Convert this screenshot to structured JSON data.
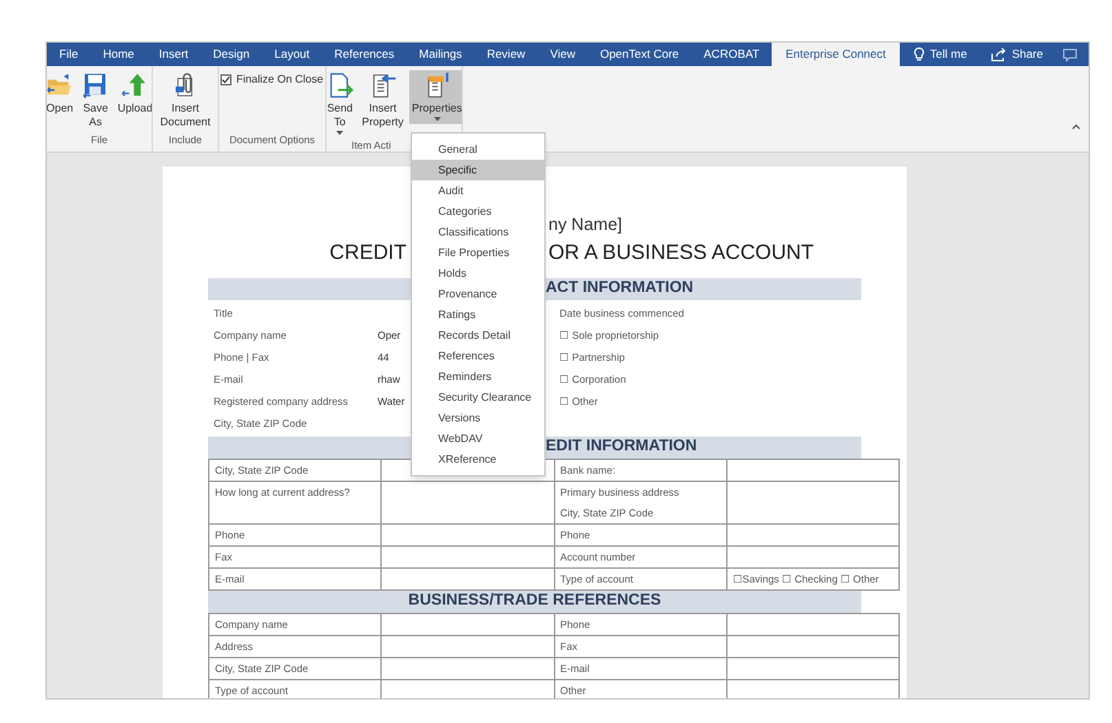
{
  "tabs": [
    {
      "label": "File",
      "selected": false
    },
    {
      "label": "Home",
      "selected": false
    },
    {
      "label": "Insert",
      "selected": false
    },
    {
      "label": "Design",
      "selected": false
    },
    {
      "label": "Layout",
      "selected": false
    },
    {
      "label": "References",
      "selected": false
    },
    {
      "label": "Mailings",
      "selected": false
    },
    {
      "label": "Review",
      "selected": false
    },
    {
      "label": "View",
      "selected": false
    },
    {
      "label": "OpenText Core",
      "selected": false
    },
    {
      "label": "ACROBAT",
      "selected": false
    },
    {
      "label": "Enterprise Connect",
      "selected": true
    }
  ],
  "tell_me": "Tell me",
  "share": "Share",
  "ribbon": {
    "groups": [
      {
        "label": "File",
        "items": [
          {
            "kind": "button",
            "label": "Open"
          },
          {
            "kind": "button",
            "label": "Save As"
          },
          {
            "kind": "button",
            "label": "Upload"
          }
        ]
      },
      {
        "label": "Include",
        "items": [
          {
            "kind": "button",
            "label": "Insert Document"
          }
        ]
      },
      {
        "label": "Document Options",
        "items": [
          {
            "kind": "checkbox",
            "label": "Finalize On Close",
            "checked": true
          }
        ]
      },
      {
        "label": "Item Acti",
        "items": [
          {
            "kind": "button",
            "label": "Send To",
            "dropdown": true
          },
          {
            "kind": "button",
            "label": "Insert Property"
          },
          {
            "kind": "button",
            "label": "Properties",
            "dropdown": true,
            "pressed": true
          }
        ]
      }
    ]
  },
  "menu": {
    "items": [
      {
        "label": "General",
        "selected": false
      },
      {
        "label": "Specific",
        "selected": true
      },
      {
        "label": "Audit",
        "selected": false
      },
      {
        "label": "Categories",
        "selected": false
      },
      {
        "label": "Classifications",
        "selected": false
      },
      {
        "label": "File Properties",
        "selected": false
      },
      {
        "label": "Holds",
        "selected": false
      },
      {
        "label": "Provenance",
        "selected": false
      },
      {
        "label": "Ratings",
        "selected": false
      },
      {
        "label": "Records Detail",
        "selected": false
      },
      {
        "label": "References",
        "selected": false
      },
      {
        "label": "Reminders",
        "selected": false
      },
      {
        "label": "Security Clearance",
        "selected": false
      },
      {
        "label": "Versions",
        "selected": false
      },
      {
        "label": "WebDAV",
        "selected": false
      },
      {
        "label": "XReference",
        "selected": false
      }
    ]
  },
  "document": {
    "company_name": "ny Name]",
    "title_left": "CREDIT",
    "title_right": "OR A BUSINESS ACCOUNT",
    "contact": {
      "heading": "ACT INFORMATION",
      "rows": [
        {
          "label": "Title",
          "right": "Date business commenced"
        },
        {
          "label": "Company name",
          "value": "Oper",
          "right": "☐ Sole proprietorship"
        },
        {
          "label": "Phone | Fax",
          "value": "44",
          "right": "☐ Partnership"
        },
        {
          "label": "E-mail",
          "value": "rhaw",
          "right": "☐ Corporation"
        },
        {
          "label": "Registered company address",
          "value": "Water",
          "right": "☐ Other"
        },
        {
          "label": "City, State ZIP Code"
        }
      ]
    },
    "credit": {
      "heading": "EDIT INFORMATION",
      "rows": [
        {
          "column_1": "City, State ZIP Code",
          "column_3": "Bank name:"
        },
        {
          "column_1": "How long at current address?",
          "column_3": "Primary business address\nCity, State ZIP Code"
        },
        {
          "column_1": "Phone",
          "column_3": "Phone"
        },
        {
          "column_1": "Fax",
          "column_3": "Account number"
        },
        {
          "column_1": "E-mail",
          "column_3": "Type of account",
          "column_4": "☐Savings ☐ Checking ☐ Other"
        }
      ]
    },
    "references": {
      "heading": "BUSINESS/TRADE REFERENCES",
      "rows": [
        {
          "column_1": "Company name",
          "column_3": "Phone"
        },
        {
          "column_1": "Address",
          "column_3": "Fax"
        },
        {
          "column_1": "City, State ZIP Code",
          "column_3": "E-mail"
        },
        {
          "column_1": "Type of account",
          "column_3": "Other"
        }
      ]
    }
  }
}
